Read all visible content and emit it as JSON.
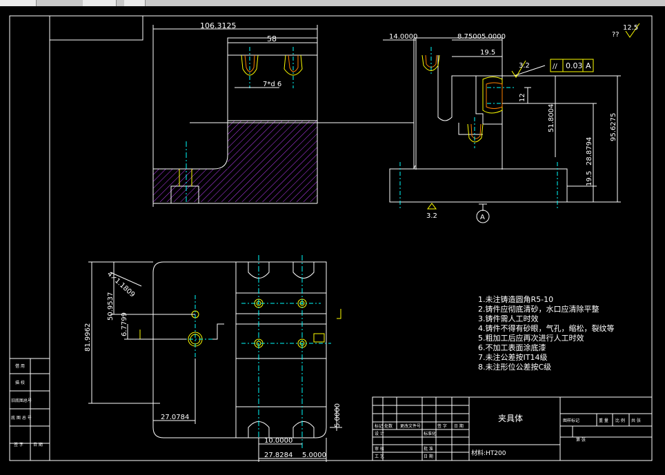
{
  "window": {
    "title": ""
  },
  "colors": {
    "background": "#000000",
    "line": "#ffffff",
    "dimension": "#ffffff",
    "center_line": "#00ffff",
    "hatch": "#c040ff",
    "yellow": "#ffff00",
    "orange": "#ff8000"
  },
  "drawing": {
    "top_view": {
      "dims": {
        "overall_width": "106.3125",
        "slot_span": "58",
        "thread": "7*d 6"
      }
    },
    "side_view": {
      "dims": {
        "d_14": "14.0000",
        "d_top_b": "8.7500",
        "d_top_c": "5.0000",
        "d_19_5": "19.5",
        "d_12": "12",
        "d_51_8": "51.8004",
        "d_95_6": "95.6275",
        "d_19_5_low": "19.5",
        "d_28": "28.8794"
      },
      "surface_finish": "3.2",
      "bottom_surface_finish": "3.2",
      "datum_label": "A",
      "tolerance": {
        "symbol": "//",
        "value": "0.03",
        "datum": "A"
      }
    },
    "roughness_corner": {
      "prefix": "??",
      "value": "12.5"
    },
    "front_view": {
      "dims": {
        "chamfer": "4×1.1809",
        "d_50_9": "50.9537",
        "d_81_9": "81.9962",
        "d_6_7": "6.7799",
        "d_27_07": "27.0784",
        "d_10": "10.0000",
        "d_27_82": "27.8284",
        "d_5_bottom": "5.0000",
        "d_5_right": "5.0000"
      }
    },
    "notes": [
      "1.未注铸造圆角R5-10",
      "2.铸件应彻底清砂，水口应清除平整",
      "3.铸件需人工时效",
      "4.铸件不得有砂眼，气孔，缩松，裂纹等",
      "5.粗加工后应再次进行人工时效",
      "6.不加工表面涂底漆",
      "7.未注公差按IT14级",
      "8.未注形位公差按C级"
    ],
    "title_block": {
      "part_name": "夹具体",
      "material": "材料:HT200",
      "left_cells": [
        "标记",
        "处数",
        "更改文件号",
        "签 字",
        "日 期"
      ],
      "rows": [
        "设 计",
        "标准化",
        "审 核",
        "工 艺",
        "批 准",
        "日 期"
      ],
      "right_headers": [
        "图样标记",
        "重 量",
        "比 例",
        "共 张",
        "第 张"
      ]
    },
    "left_block": [
      "借 用",
      "描 校",
      "旧底图总号",
      "底 图 总 号",
      "签 字",
      "日 期"
    ]
  }
}
